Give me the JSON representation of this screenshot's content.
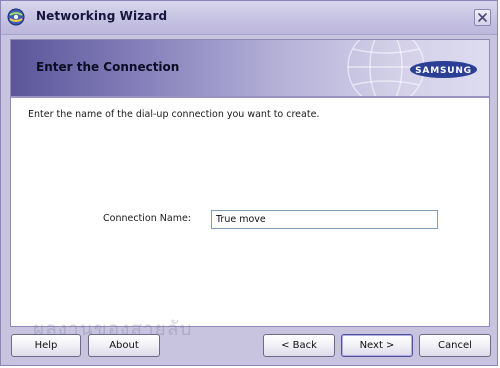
{
  "window": {
    "title": "Networking Wizard"
  },
  "banner": {
    "title": "Enter the Connection",
    "logo_text": "SAMSUNG"
  },
  "body": {
    "instruction": "Enter the name of the dial-up connection you want to create.",
    "connection_name_label": "Connection Name:",
    "connection_name_value": "True move"
  },
  "watermark": "ผลงานของสายลับ",
  "buttons": {
    "help": "Help",
    "about": "About",
    "back": "< Back",
    "next": "Next >",
    "cancel": "Cancel"
  },
  "colors": {
    "frame": "#c8c4e0",
    "banner_dark": "#5b5699",
    "banner_light": "#dedcef",
    "logo_blue": "#2a3f95"
  },
  "icons": {
    "app": "networking-wizard-app-icon",
    "close": "close-icon",
    "globe": "globe-watermark-icon"
  }
}
